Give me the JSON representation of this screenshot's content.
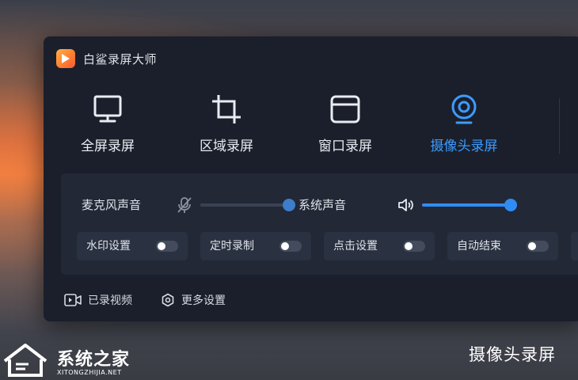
{
  "app": {
    "title": "白鲨录屏大师"
  },
  "modes": [
    {
      "label": "全屏录屏",
      "icon": "monitor-icon",
      "active": false
    },
    {
      "label": "区域录屏",
      "icon": "crop-icon",
      "active": false
    },
    {
      "label": "窗口录屏",
      "icon": "window-icon",
      "active": false
    },
    {
      "label": "摄像头录屏",
      "icon": "webcam-icon",
      "active": true
    }
  ],
  "audio": {
    "mic_label": "麦克风声音",
    "mic_icon": "mic-muted-icon",
    "mic_level": 1.0,
    "system_label": "系统声音",
    "system_icon": "speaker-icon",
    "system_level": 1.0
  },
  "toggles": [
    {
      "label": "水印设置",
      "on": false
    },
    {
      "label": "定时录制",
      "on": false
    },
    {
      "label": "点击设置",
      "on": false
    },
    {
      "label": "自动结束",
      "on": false
    }
  ],
  "footer": {
    "recorded_label": "已录视频",
    "recorded_icon": "video-icon",
    "settings_label": "更多设置",
    "settings_icon": "settings-hex-icon"
  },
  "caption": "摄像头录屏",
  "watermark": {
    "name": "系统之家",
    "url": "XITONGZHIJIA.NET"
  },
  "colors": {
    "accent": "#3d9bff",
    "window_bg": "#1a1f2b",
    "panel_bg": "#222836"
  }
}
